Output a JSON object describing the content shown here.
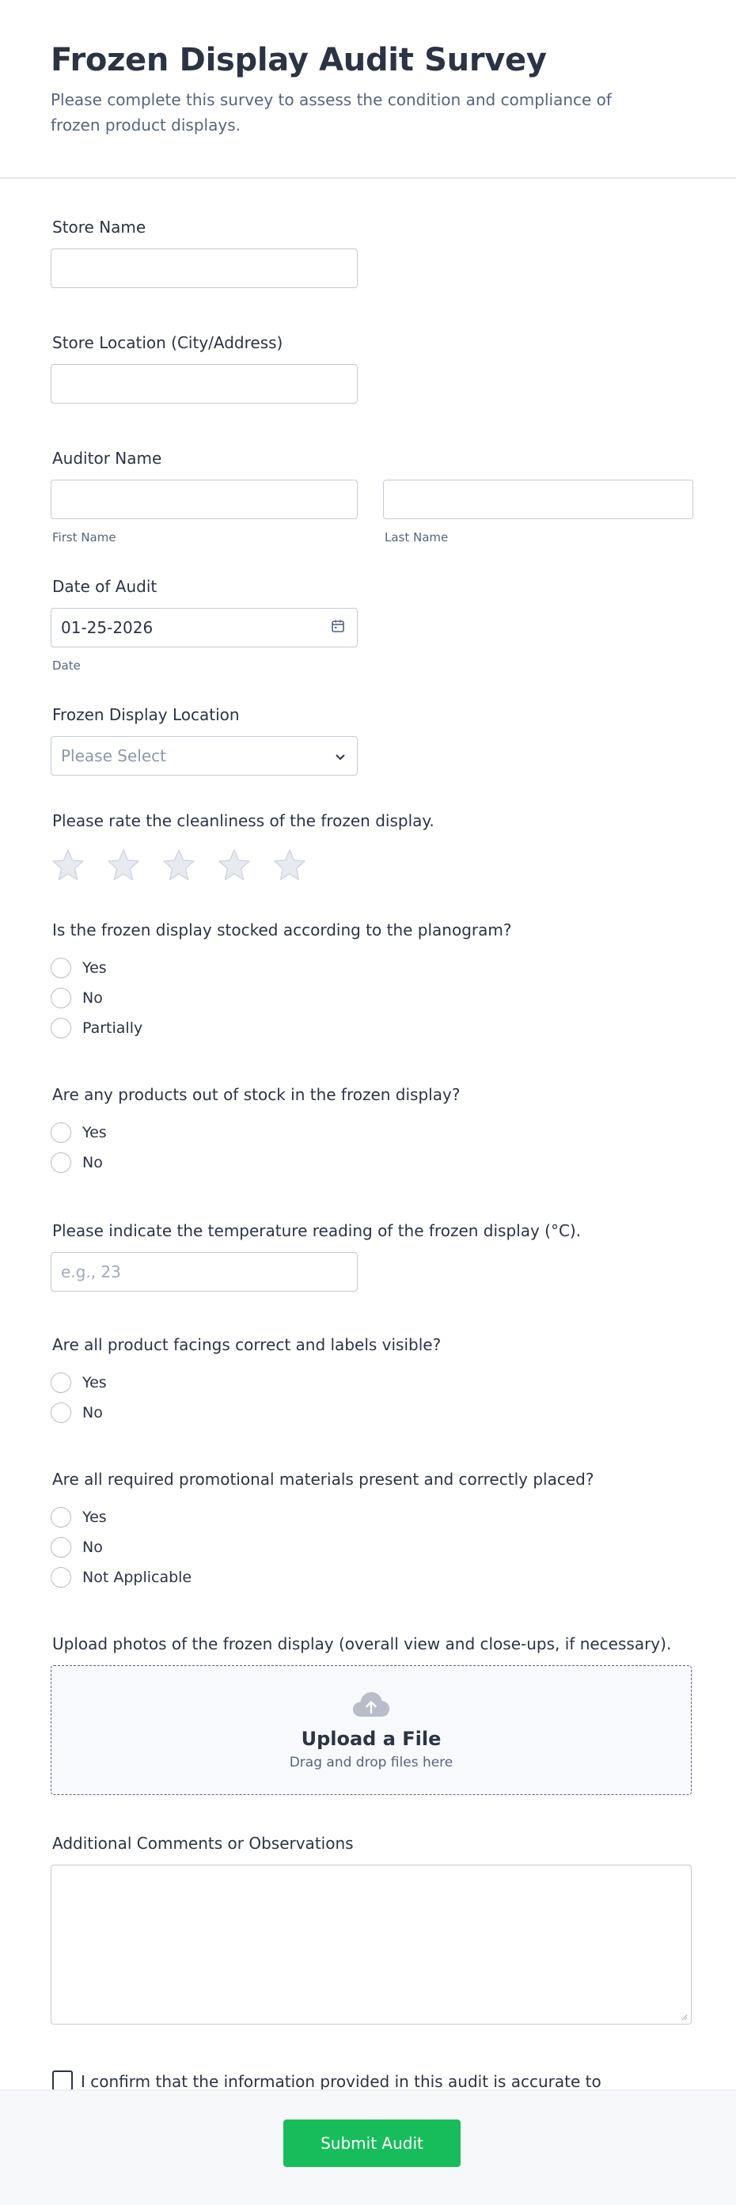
{
  "header": {
    "title": "Frozen Display Audit Survey",
    "description": "Please complete this survey to assess the condition and compliance of frozen product displays."
  },
  "store_name": {
    "label": "Store Name",
    "value": ""
  },
  "store_location": {
    "label": "Store Location (City/Address)",
    "value": ""
  },
  "auditor": {
    "label": "Auditor Name",
    "first_sublabel": "First Name",
    "last_sublabel": "Last Name"
  },
  "date": {
    "label": "Date of Audit",
    "value": "01-25-2026",
    "sublabel": "Date",
    "icon": "calendar-icon"
  },
  "display_location": {
    "label": "Frozen Display Location",
    "selected": "Please Select",
    "icon": "chevron-down-icon"
  },
  "cleanliness": {
    "label": "Please rate the cleanliness of the frozen display.",
    "max_rating": 5,
    "rating": 0,
    "icon": "star-icon"
  },
  "planogram": {
    "label": "Is the frozen display stocked according to the planogram?",
    "options": [
      "Yes",
      "No",
      "Partially"
    ]
  },
  "out_of_stock": {
    "label": "Are any products out of stock in the frozen display?",
    "options": [
      "Yes",
      "No"
    ]
  },
  "temperature": {
    "label": "Please indicate the temperature reading of the frozen display (°C).",
    "placeholder": "e.g., 23"
  },
  "facings": {
    "label": "Are all product facings correct and labels visible?",
    "options": [
      "Yes",
      "No"
    ]
  },
  "promo": {
    "label": "Are all required promotional materials present and correctly placed?",
    "options": [
      "Yes",
      "No",
      "Not Applicable"
    ]
  },
  "upload": {
    "label": "Upload photos of the frozen display (overall view and close-ups, if necessary).",
    "title": "Upload a File",
    "subtitle": "Drag and drop files here",
    "icon": "cloud-upload-icon"
  },
  "comments": {
    "label": "Additional Comments or Observations",
    "value": ""
  },
  "confirm": {
    "text": "I confirm that the information provided in this audit is accurate to the best of my knowledge.",
    "required_mark": "*"
  },
  "submit": {
    "label": "Submit Audit"
  },
  "colors": {
    "accent": "#18bd5b",
    "required": "#f97e3a",
    "star": "#e3e5ee"
  }
}
